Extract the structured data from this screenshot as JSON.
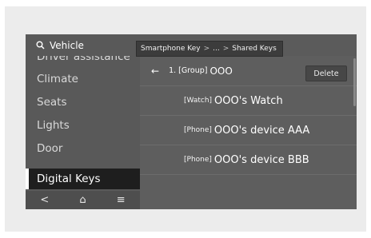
{
  "sidebar": {
    "header": {
      "label": "Vehicle",
      "icon": "search-icon"
    },
    "items": [
      {
        "label": "Driver assistance"
      },
      {
        "label": "Climate"
      },
      {
        "label": "Seats"
      },
      {
        "label": "Lights"
      },
      {
        "label": "Door"
      },
      {
        "label": "Digital Keys"
      }
    ],
    "bottom_bar": {
      "back": "<",
      "home": "⌂",
      "menu": "≡"
    }
  },
  "breadcrumb": {
    "items": [
      "Smartphone Key",
      "...",
      "Shared Keys"
    ],
    "separator": ">"
  },
  "main": {
    "back_icon": "←",
    "group_label": "1. [Group]",
    "group_value": "OOO",
    "delete_label": "Delete",
    "devices": [
      {
        "tag": "[Watch]",
        "name": "OOO's Watch"
      },
      {
        "tag": "[Phone]",
        "name": "OOO's device AAA"
      },
      {
        "tag": "[Phone]",
        "name": "OOO's device BBB"
      }
    ]
  }
}
